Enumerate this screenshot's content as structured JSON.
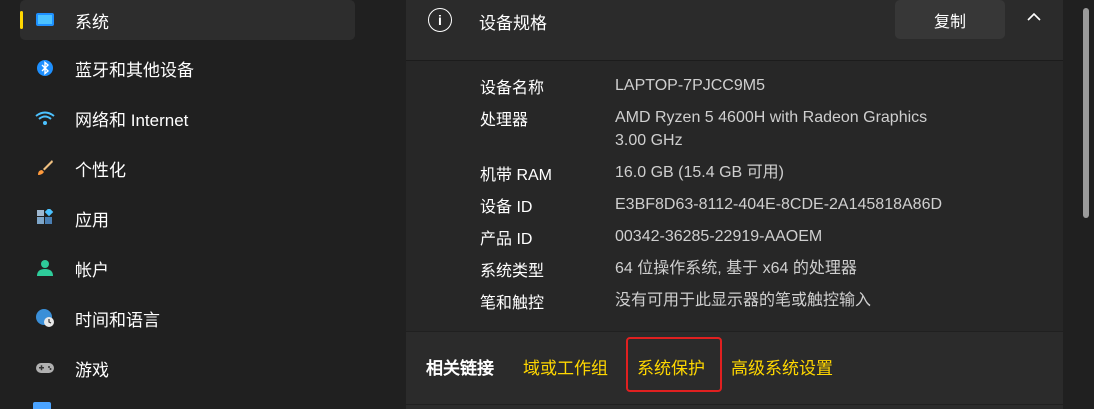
{
  "sidebar": {
    "items": [
      {
        "label": "系统",
        "icon": "display-icon",
        "selected": true
      },
      {
        "label": "蓝牙和其他设备",
        "icon": "bluetooth-icon"
      },
      {
        "label": "网络和 Internet",
        "icon": "wifi-icon"
      },
      {
        "label": "个性化",
        "icon": "brush-icon"
      },
      {
        "label": "应用",
        "icon": "apps-icon"
      },
      {
        "label": "帐户",
        "icon": "person-icon"
      },
      {
        "label": "时间和语言",
        "icon": "globe-clock-icon"
      },
      {
        "label": "游戏",
        "icon": "gamepad-icon"
      }
    ]
  },
  "device_specs": {
    "title": "设备规格",
    "copy_label": "复制",
    "rows": [
      {
        "key": "设备名称",
        "value": "LAPTOP-7PJCC9M5"
      },
      {
        "key": "处理器",
        "value": "AMD Ryzen 5 4600H with Radeon Graphics",
        "value2": "3.00 GHz"
      },
      {
        "key": "机带 RAM",
        "value": "16.0 GB (15.4 GB 可用)"
      },
      {
        "key": "设备 ID",
        "value": "E3BF8D63-8112-404E-8CDE-2A145818A86D"
      },
      {
        "key": "产品 ID",
        "value": "00342-36285-22919-AAOEM"
      },
      {
        "key": "系统类型",
        "value": "64 位操作系统, 基于 x64 的处理器"
      },
      {
        "key": "笔和触控",
        "value": "没有可用于此显示器的笔或触控输入"
      }
    ]
  },
  "related_links": {
    "label": "相关链接",
    "links": [
      "域或工作组",
      "系统保护",
      "高级系统设置"
    ]
  },
  "colors": {
    "accent": "#ffd700",
    "highlight": "#e02020",
    "background": "#202020"
  }
}
